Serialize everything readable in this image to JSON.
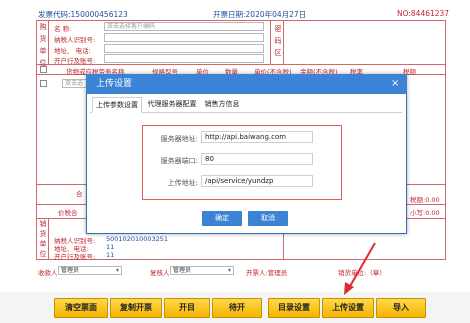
{
  "invoice": {
    "code_line": "发票代码:150000456123",
    "date_line": "开票日期:2020年04月27日",
    "no_line": "NO:84461237",
    "buyer_side": [
      "购",
      "货",
      "单",
      "位"
    ],
    "buyer_name_label": "名      称:",
    "buyer_name_placeholder": "双击选择客户编码",
    "buyer_taxid_label": "纳税人识别号:",
    "buyer_addr_label": "地址、 电话:",
    "buyer_bank_label": "开户行及账号:",
    "pwd_side": [
      "密",
      "码",
      "区"
    ],
    "columns": [
      "货物或应税劳务名称",
      "规格型号",
      "单位",
      "数量",
      "单价(不含税)",
      "金额(不含税)",
      "税率",
      "税额"
    ],
    "row1_placeholder": "双击选",
    "total_label": "合",
    "price_tax_label": "价税合",
    "tax_total_right": "税额:0.00",
    "small_total_right": "小写:0.00",
    "seller_side": [
      "销",
      "货",
      "单",
      "位"
    ],
    "seller_taxid_label": "纳税人识别号:",
    "seller_taxid_value": "500102010003251",
    "seller_addr_label": "地址、电话:",
    "seller_addr_value": "11",
    "seller_bank_label": "开户行及账号:",
    "seller_bank_value": "11",
    "payee_label": "收款人:",
    "payee_value": "管理员",
    "reviewer_label": "复核人:",
    "reviewer_value": "管理员",
    "drawer_label": "开票人:管理员",
    "seller_stamp_label": "销货单位:（章）"
  },
  "toolbar": {
    "buttons": [
      "清空票面",
      "复制开票",
      "开目",
      "待开",
      "目录设置",
      "上传设置",
      "导入"
    ]
  },
  "modal": {
    "title": "上传设置",
    "close": "×",
    "tabs": [
      "上传参数设置",
      "代理服务器配置",
      "销售方信息"
    ],
    "server_label": "服务器地址:",
    "server_value": "http://api.baiwang.com",
    "port_label": "服务器端口:",
    "port_value": "80",
    "upload_label": "上传地址:",
    "upload_value": "/api/service/yundzp",
    "confirm": "确定",
    "cancel": "取消"
  },
  "colors": {
    "accent": "#3c83d6",
    "invoice_red": "#c0262d",
    "toolbar_yellow": "#f4b400",
    "highlight_red": "#e05a5a"
  }
}
